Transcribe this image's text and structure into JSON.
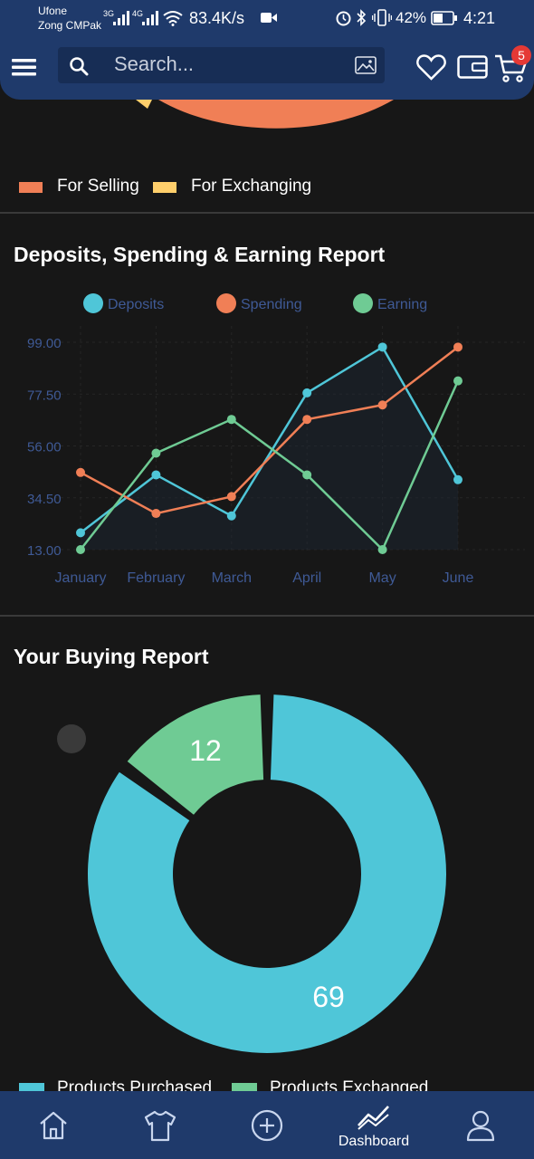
{
  "status_bar": {
    "carrier1": "Ufone",
    "carrier2": "Zong CMPak",
    "sig1": "3G",
    "sig2": "4G",
    "net_speed": "83.4K/s",
    "battery": "42%",
    "time": "4:21"
  },
  "header": {
    "search_placeholder": "Search...",
    "cart_count": "5"
  },
  "pie_section": {
    "legend": [
      {
        "label": "For Selling",
        "color": "#f07f56"
      },
      {
        "label": "For Exchanging",
        "color": "#ffcf6b"
      }
    ]
  },
  "deposits_section": {
    "title": "Deposits, Spending & Earning Report"
  },
  "buying_section": {
    "title": "Your Buying Report",
    "legend": [
      {
        "label": "Products Purchased",
        "color": "#4fc6d8"
      },
      {
        "label": "Products Exchanged",
        "color": "#6fcb94"
      }
    ]
  },
  "nav": {
    "items": [
      {
        "label": "",
        "icon": "home-icon"
      },
      {
        "label": "",
        "icon": "shirt-icon"
      },
      {
        "label": "",
        "icon": "plus-circle-icon"
      },
      {
        "label": "Dashboard",
        "icon": "chart-icon"
      },
      {
        "label": "",
        "icon": "user-icon"
      }
    ]
  },
  "chart_data": [
    {
      "type": "pie",
      "categories": [
        "For Selling",
        "For Exchanging"
      ],
      "colors": [
        "#f07f56",
        "#ffcf6b"
      ]
    },
    {
      "type": "line",
      "x": [
        "January",
        "February",
        "March",
        "April",
        "May",
        "June"
      ],
      "y_ticks": [
        "99.00",
        "77.50",
        "56.00",
        "34.50",
        "13.00"
      ],
      "ylim": [
        13,
        99
      ],
      "legend_position": "top",
      "grid": true,
      "series": [
        {
          "name": "Deposits",
          "color": "#4fc6d8",
          "values": [
            20,
            44,
            27,
            78,
            97,
            42
          ]
        },
        {
          "name": "Spending",
          "color": "#f07f56",
          "values": [
            45,
            28,
            35,
            67,
            73,
            97
          ]
        },
        {
          "name": "Earning",
          "color": "#6fcb94",
          "values": [
            13,
            53,
            67,
            44,
            13,
            83
          ]
        }
      ]
    },
    {
      "type": "pie",
      "categories": [
        "Products Purchased",
        "Products Exchanged"
      ],
      "values": [
        69,
        12
      ],
      "colors": [
        "#4fc6d8",
        "#6fcb94"
      ]
    }
  ]
}
